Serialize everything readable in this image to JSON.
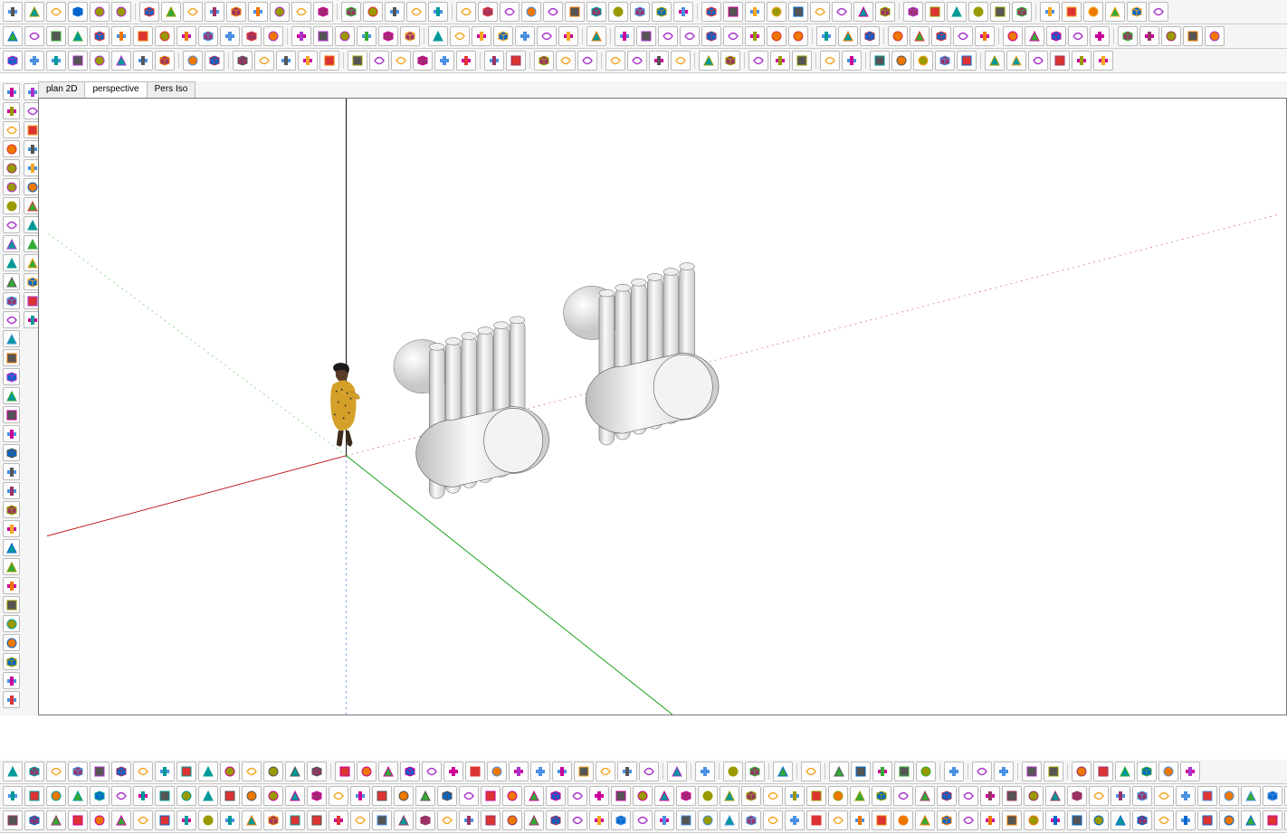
{
  "tabs": {
    "plan": "plan 2D",
    "persp": "perspective",
    "iso": "Pers Iso"
  },
  "toolbar_top_rows": [
    [
      "logo",
      "play",
      "stop",
      "win-tile",
      "win-cascade",
      "gear",
      "sep",
      "cursor-brush",
      "lasso",
      "cursor-add",
      "cursor-remove",
      "person",
      "zoom-fit",
      "zoom-extents",
      "orbit",
      "pan",
      "sep",
      "stroke-free",
      "edit-vertex",
      "stroke-pink",
      "stroke-green",
      "pencil-green",
      "sep",
      "arc-red",
      "arc-orange",
      "arc-green",
      "arc-blue",
      "circle-red",
      "ellipse",
      "curve-cyan",
      "chevron-red",
      "chevron-green",
      "poly-blue",
      "wave",
      "sep",
      "box-red",
      "cylinder-red",
      "cone-red",
      "sphere-cyan",
      "box-yellow",
      "prism-blue",
      "prism-yellow",
      "box-blue",
      "torus",
      "sep",
      "layers-blue",
      "layers-green",
      "stack-red",
      "stack-blue",
      "stack-green",
      "stack-purple",
      "sep",
      "box-iso-1",
      "box-iso-2",
      "box-iso-3",
      "box-iso-4",
      "box-iso-5",
      "box-iso-6"
    ],
    [
      "shield-blue",
      "knot",
      "arrow-down-red",
      "box-sm-red",
      "letter-j",
      "box-iso-a",
      "box-iso-b",
      "letter-n",
      "box-yellow-sm",
      "person-icon",
      "letter-f",
      "letter-p",
      "letter-p2",
      "sep",
      "surface-a",
      "surface-b",
      "surface-c",
      "revolve",
      "loft",
      "extrude",
      "sep",
      "sweep-a",
      "shirt",
      "helmet",
      "box-shade",
      "bag-blue",
      "rotate-blue",
      "bag-purple",
      "sep",
      "script-fx",
      "sep",
      "text-black",
      "text-orange",
      "arrow-long",
      "arrow-short",
      "arrow-up",
      "bounce",
      "slash",
      "grid-blue",
      "surf-x",
      "sep",
      "union",
      "subtract",
      "intersect",
      "sep",
      "cube-red-a",
      "cube-red-b",
      "cube-red-c",
      "cube-red-d",
      "cube-red-e",
      "sep",
      "brick-a",
      "brick-b",
      "brick-c",
      "brick-d",
      "brick-e",
      "sep",
      "globe",
      "pin",
      "maps",
      "tree",
      "osm"
    ],
    [
      "doc-new",
      "doc-open",
      "eraser-orange",
      "folder-a",
      "folder-b",
      "folder-c",
      "wizard",
      "curve-s",
      "sep",
      "copy",
      "paste",
      "sep",
      "person-a",
      "person-b",
      "person-c",
      "frame",
      "gear-sm",
      "sep",
      "arrow-v",
      "dim",
      "compass",
      "target",
      "curve-fit",
      "tangent",
      "sep",
      "box-wire-a",
      "box-wire-b",
      "sep",
      "face-red-a",
      "face-red-b",
      "eraser-red",
      "sep",
      "sel-arrow",
      "sel-green-a",
      "sel-green-b",
      "sel-red",
      "sep",
      "mat-a",
      "mat-b",
      "sep",
      "win-a",
      "win-b",
      "win-c",
      "sep",
      "snap-a",
      "snap-b",
      "sep",
      "grid-red",
      "cursor-snap",
      "dim-h",
      "dim-v",
      "rotate-snap",
      "sep",
      "line",
      "rect",
      "poly",
      "circle",
      "spiral",
      "explode"
    ]
  ],
  "side_tools": [
    "home",
    "cube-view",
    "magnet",
    "pencil",
    "eraser-pink",
    "squiggle-red",
    "wave-grey",
    "rect-grey",
    "rect-shade",
    "hatch",
    "donut",
    "arc-red-sm",
    "poly-red",
    "flag-red",
    "flag-black",
    "script",
    "cart",
    "push",
    "swap",
    "arrow-fwd",
    "arrow-back",
    "refresh",
    "globe-pin",
    "scissors-grn",
    "zoom-lens",
    "cursor-q",
    "doc-ai",
    "note",
    "pen-black",
    "grid-red-sm",
    "cog",
    "pan-hand",
    "cube-grn",
    "cube-grn2",
    "zoom-r",
    "zoom-b",
    "grid-r",
    "grid-r2",
    "eye",
    "hide",
    "sun",
    "sun2",
    "ribbon-a",
    "ribbon-b",
    "cube-grn3",
    "dot"
  ],
  "viewport": {
    "x_axis_color": "#cc0000",
    "y_axis_color": "#009900",
    "z_axis_color": "#3366cc",
    "figure": "person-reference"
  },
  "bottom_toolbar_rows": [
    [
      "doc-a",
      "doc-b",
      "doc-c",
      "save",
      "save-as",
      "save-c",
      "tile-a",
      "tile-b",
      "tile-c",
      "grid-view",
      "grid-b",
      "cut",
      "paste-a",
      "paste-b",
      "paste-c",
      "sep",
      "col-a",
      "col-b",
      "col-c",
      "col-d",
      "col-e",
      "col-f",
      "cross",
      "checker",
      "stripe",
      "wave-bar",
      "fan",
      "pipe",
      "rect-o",
      "label-2d",
      "toggle",
      "sep",
      "widget",
      "sep",
      "flask",
      "sep",
      "mirror",
      "sky",
      "sep",
      "fillet",
      "sep",
      "radar",
      "sep",
      "arrow-r",
      "box-x",
      "box-k",
      "box-l",
      "box-m",
      "sep",
      "k-shape",
      "sep",
      "box-x2",
      "swap2",
      "sep",
      "undo2",
      "play2",
      "sep",
      "undo-z",
      "scissor",
      "curl",
      "arrow-back2",
      "dot-y",
      "help"
    ],
    [
      "boxes-row",
      "many-cubes"
    ],
    [
      "cursor",
      "boxes",
      "cubes",
      "bars-a",
      "bars-b",
      "bars-c",
      "plus",
      "minus",
      "dot",
      "text-on",
      "text-off",
      "hatch-a",
      "hatch-b",
      "copy-btn",
      "move-btn",
      "stretch",
      "arrows",
      "gizmo",
      "many-tools"
    ]
  ]
}
